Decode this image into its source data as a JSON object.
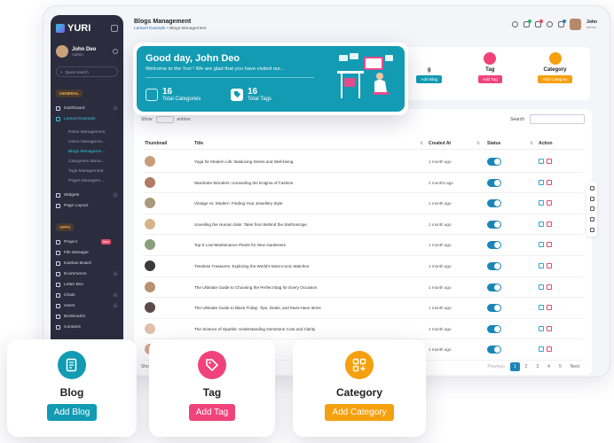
{
  "app": {
    "brand": "YURI"
  },
  "colors": {
    "teal": "#129bb3",
    "pink": "#f0437a",
    "orange": "#f5a00e",
    "blueBtn": "#1a86b8",
    "sidebar": "#2b2d3e"
  },
  "sidebar": {
    "user": {
      "name": "John Deo",
      "role": "Admin"
    },
    "quick_search": "Quick search",
    "section_general": "GENERAL",
    "section_apps": "APPS",
    "items_general": [
      {
        "label": "Dashboard",
        "icon": "home-icon"
      },
      {
        "label": "Laravel Example",
        "icon": "layers-icon"
      }
    ],
    "sub_items": [
      "Roles Management",
      "Users Manageme...",
      "Blogs Manageme...",
      "Categories Mana...",
      "Tags Management",
      "Pages Managem..."
    ],
    "items_after": [
      {
        "label": "Widgets",
        "icon": "widgets-icon"
      },
      {
        "label": "Page Layout",
        "icon": "layout-icon"
      }
    ],
    "items_apps": [
      {
        "label": "Project",
        "icon": "project-icon",
        "badge": "New"
      },
      {
        "label": "File Manager",
        "icon": "folder-icon"
      },
      {
        "label": "Kanban Board",
        "icon": "kanban-icon"
      },
      {
        "label": "Ecommerce",
        "icon": "cart-icon"
      },
      {
        "label": "Letter Box",
        "icon": "mail-icon"
      },
      {
        "label": "Chats",
        "icon": "chat-icon"
      },
      {
        "label": "Users",
        "icon": "users-icon"
      },
      {
        "label": "Bookmarks",
        "icon": "bookmark-icon"
      },
      {
        "label": "Contacts",
        "icon": "contacts-icon"
      }
    ]
  },
  "header": {
    "title": "Blogs Management",
    "breadcrumb_root": "Laravel Example",
    "breadcrumb_current": "Blogs Management",
    "user_name": "John",
    "user_role": "admin"
  },
  "welcome": {
    "greeting": "Good day, John Deo",
    "subtitle": "Welcome to the Yuri ! We are glad that you have visited our...",
    "categories_count": "16",
    "categories_label": "Total Categories",
    "tags_count": "16",
    "tags_label": "Total Tags"
  },
  "mini_cards": [
    {
      "title": "g",
      "button": "Add Blog"
    },
    {
      "title": "Tag",
      "button": "Add Tag"
    },
    {
      "title": "Category",
      "button": "Add Category"
    }
  ],
  "table": {
    "show_label": "Show",
    "entries_label": "entries",
    "search_label": "Search",
    "columns": [
      "Thumbnail",
      "Title",
      "Created At",
      "Status",
      "Action"
    ],
    "rows": [
      {
        "title": "Yoga for Modern Life: Balancing Stress and Well-being",
        "created": "1 month ago",
        "thumb": "#c89b7b"
      },
      {
        "title": "Wardrobe Wonders: Unraveling the Enigma of Fashion",
        "created": "2 months ago",
        "thumb": "#b07a64"
      },
      {
        "title": "Vintage vs. Modern: Finding Your Jewellery Style",
        "created": "1 month ago",
        "thumb": "#a89a7a"
      },
      {
        "title": "Unveiling the Human Side: Tales from Behind the Stethoscope",
        "created": "1 month ago",
        "thumb": "#d6b48a"
      },
      {
        "title": "Top 5 Low-Maintenance Plants for New Gardeners",
        "created": "1 month ago",
        "thumb": "#8aa07a"
      },
      {
        "title": "Timeless Treasures: Exploring the World's Most Iconic Watches",
        "created": "1 month ago",
        "thumb": "#3a3a3a"
      },
      {
        "title": "The Ultimate Guide to Choosing the Perfect Bag for Every Occasion",
        "created": "1 month ago",
        "thumb": "#b89070"
      },
      {
        "title": "The Ultimate Guide to Black Friday: Tips, Deals, and Must-Have Items",
        "created": "1 month ago",
        "thumb": "#5a4a4a"
      },
      {
        "title": "The Science of Sparkle: Understanding Gemstone Cuts and Clarity",
        "created": "1 month ago",
        "thumb": "#e0c0a8"
      },
      {
        "title": "Express X",
        "created": "1 month ago",
        "thumb": "#d8a890"
      }
    ],
    "showing": "Show",
    "pagination": [
      "Previous",
      "1",
      "2",
      "3",
      "4",
      "5",
      "Next"
    ]
  },
  "bottom_cards": [
    {
      "title": "Blog",
      "button": "Add Blog",
      "icon": "document-icon"
    },
    {
      "title": "Tag",
      "button": "Add Tag",
      "icon": "tag-icon"
    },
    {
      "title": "Category",
      "button": "Add Category",
      "icon": "category-grid-icon"
    }
  ]
}
